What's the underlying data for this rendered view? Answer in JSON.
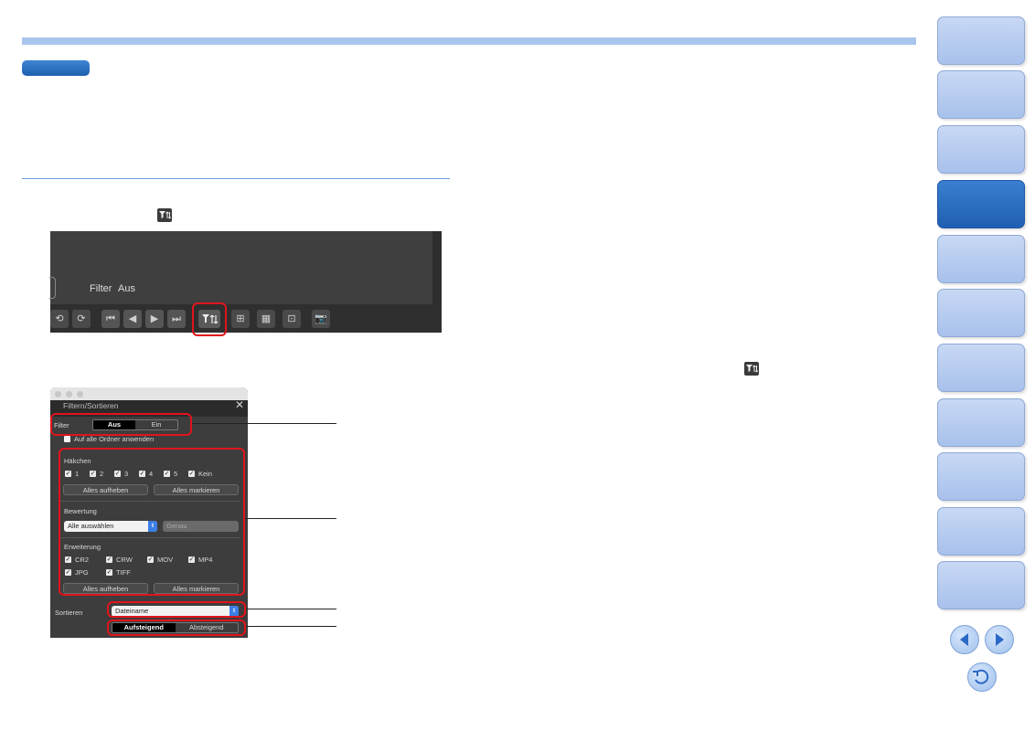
{
  "toolbar_screenshot": {
    "filter_label": "Filter",
    "filter_value": "Aus"
  },
  "panel": {
    "title": "Filtern/Sortieren",
    "close_glyph": "✕",
    "filter_label": "Filter",
    "filter_options": [
      "Aus",
      "Ein"
    ],
    "filter_selected": "Aus",
    "apply_all_label": "Auf alle Ordner anwenden",
    "apply_all_checked": false,
    "checkmarks": {
      "heading": "Häkchen",
      "items": [
        "1",
        "2",
        "3",
        "4",
        "5",
        "Kein"
      ],
      "clear_button": "Alles aufheben",
      "select_button": "Alles markieren"
    },
    "rating": {
      "heading": "Bewertung",
      "select_value": "Alle auswählen",
      "mode_value": "Genau"
    },
    "extension": {
      "heading": "Erweiterung",
      "items": [
        "CR2",
        "CRW",
        "MOV",
        "MP4",
        "JPG",
        "TIFF"
      ],
      "clear_button": "Alles aufheben",
      "select_button": "Alles markieren"
    },
    "sort": {
      "label": "Sortieren",
      "select_value": "Dateiname",
      "order_options": [
        "Aufsteigend",
        "Absteigend"
      ],
      "order_selected": "Aufsteigend"
    }
  },
  "colors": {
    "accent": "#1f5fb3",
    "highlight_red": "#e0141c",
    "nav_tab": "#b5cbef"
  },
  "icons": [
    "filter-sort-icon",
    "previous-page-icon",
    "next-page-icon",
    "return-icon",
    "camera-icon"
  ]
}
